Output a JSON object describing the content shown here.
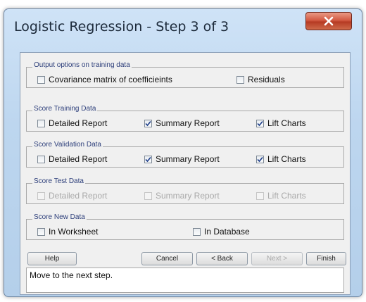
{
  "window": {
    "title": "Logistic Regression - Step 3 of 3"
  },
  "groups": [
    {
      "legend": "Output options on training data",
      "options": [
        {
          "label": "Covariance matrix of coefficieints",
          "checked": false
        },
        {
          "label": "Residuals",
          "checked": false
        }
      ]
    },
    {
      "legend": "Score Training Data",
      "options": [
        {
          "label": "Detailed Report",
          "checked": false
        },
        {
          "label": "Summary Report",
          "checked": true
        },
        {
          "label": "Lift Charts",
          "checked": true
        }
      ]
    },
    {
      "legend": "Score Validation Data",
      "options": [
        {
          "label": "Detailed Report",
          "checked": false
        },
        {
          "label": "Summary Report",
          "checked": true
        },
        {
          "label": "Lift Charts",
          "checked": true
        }
      ]
    },
    {
      "legend": "Score Test Data",
      "options": [
        {
          "label": "Detailed Report",
          "checked": false,
          "disabled": true
        },
        {
          "label": "Summary Report",
          "checked": false,
          "disabled": true
        },
        {
          "label": "Lift Charts",
          "checked": false,
          "disabled": true
        }
      ]
    },
    {
      "legend": "Score New Data",
      "options": [
        {
          "label": "In Worksheet",
          "checked": false
        },
        {
          "label": "In Database",
          "checked": false
        }
      ]
    }
  ],
  "buttons": {
    "help": "Help",
    "cancel": "Cancel",
    "back": "< Back",
    "next": "Next >",
    "finish": "Finish"
  },
  "status": {
    "message": "Move to the next step."
  },
  "icons": {
    "close": "close-icon",
    "checkbox_checked": "checkmark-icon"
  },
  "colors": {
    "title_bar": "#bdd6ef",
    "close_button": "#c94a31",
    "legend_text": "#2c3e7a"
  }
}
